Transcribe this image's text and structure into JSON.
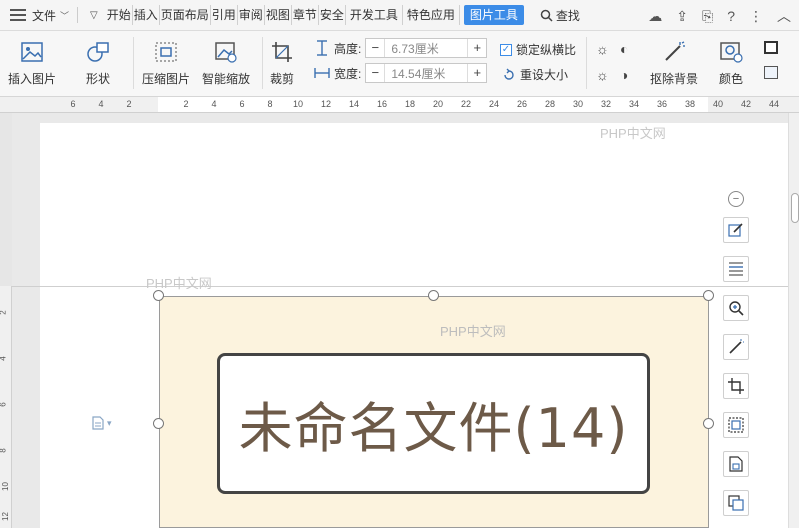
{
  "menubar": {
    "file_label": "文件",
    "tabs": [
      {
        "label": "开始"
      },
      {
        "label": "插入"
      },
      {
        "label": "页面布局"
      },
      {
        "label": "引用"
      },
      {
        "label": "审阅"
      },
      {
        "label": "视图"
      },
      {
        "label": "章节"
      },
      {
        "label": "安全"
      },
      {
        "label": "开发工具"
      },
      {
        "label": "特色应用"
      },
      {
        "label": "图片工具"
      }
    ],
    "active_tab": "图片工具",
    "search_label": "查找",
    "accent_color": "#3c8ce7"
  },
  "ribbon": {
    "insert_picture": "插入图片",
    "shape": "形状",
    "compress_picture": "压缩图片",
    "smart_scale": "智能缩放",
    "crop": "裁剪",
    "height_label": "高度:",
    "height_value": "6.73厘米",
    "width_label": "宽度:",
    "width_value": "14.54厘米",
    "lock_ratio": "锁定纵横比",
    "reset_size": "重设大小",
    "remove_background": "抠除背景",
    "color": "颜色"
  },
  "ruler": {
    "ticks": [
      "6",
      "4",
      "2",
      "2",
      "4",
      "6",
      "8",
      "10",
      "12",
      "14",
      "16",
      "18",
      "20",
      "22",
      "24",
      "26",
      "28",
      "30",
      "32",
      "34",
      "36",
      "38",
      "40",
      "42",
      "44"
    ]
  },
  "vruler": {
    "ticks": [
      "2",
      "4",
      "6",
      "8",
      "10",
      "12"
    ]
  },
  "document": {
    "image_text": "未命名文件(14)",
    "watermark": "PHP中文网"
  }
}
